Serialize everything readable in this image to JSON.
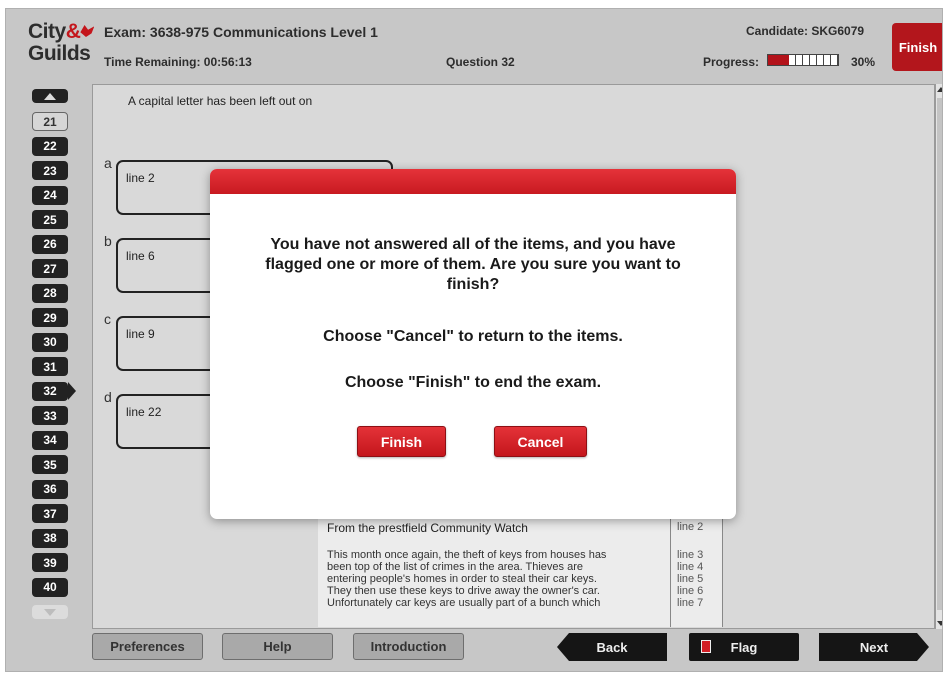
{
  "header": {
    "logo_line1": "City",
    "logo_amp": "&",
    "logo_line2": "Guilds",
    "exam_title": "Exam: 3638-975 Communications Level 1",
    "time_remaining": "Time Remaining: 00:56:13",
    "question_label": "Question 32",
    "candidate": "Candidate: SKG6079",
    "progress_label": "Progress:",
    "progress_value": 0.3,
    "progress_percent": "30%",
    "finish_label": "Finish"
  },
  "navigator": {
    "items": [
      "21",
      "22",
      "23",
      "24",
      "25",
      "26",
      "27",
      "28",
      "29",
      "30",
      "31",
      "32",
      "33",
      "34",
      "35",
      "36",
      "37",
      "38",
      "39",
      "40"
    ],
    "visited": "21",
    "current": "32"
  },
  "question": {
    "prompt": "A capital letter has been left out on",
    "options": [
      {
        "letter": "a",
        "text": "line 2"
      },
      {
        "letter": "b",
        "text": "line 6"
      },
      {
        "letter": "c",
        "text": "line 9"
      },
      {
        "letter": "d",
        "text": "line 22"
      }
    ]
  },
  "passage": {
    "title": "From the prestfield Community Watch",
    "title_line": "line 2",
    "lines": [
      {
        "text": "This month once again, the theft of keys from houses has",
        "num": "line 3"
      },
      {
        "text": "been top of the list of crimes in the area. Thieves are",
        "num": "line 4"
      },
      {
        "text": "entering people's homes in order to steal their car keys.",
        "num": "line 5"
      },
      {
        "text": "They then use these keys to drive away the owner's car.",
        "num": "line 6"
      },
      {
        "text": "Unfortunately car keys are usually part of a bunch which",
        "num": "line 7"
      }
    ]
  },
  "toolbar": {
    "preferences": "Preferences",
    "help": "Help",
    "introduction": "Introduction",
    "back": "Back",
    "flag": "Flag",
    "next": "Next"
  },
  "dialog": {
    "message": "You have not answered all of the items, and you have flagged one or more of them. Are you sure you want to finish?",
    "cancel_hint": "Choose \"Cancel\" to return to the items.",
    "finish_hint": "Choose \"Finish\" to end the exam.",
    "finish_button": "Finish",
    "cancel_button": "Cancel"
  },
  "colors": {
    "brand_red": "#c4161c",
    "navigator_dark": "#222222",
    "panel_bg": "#d9d9d9"
  }
}
